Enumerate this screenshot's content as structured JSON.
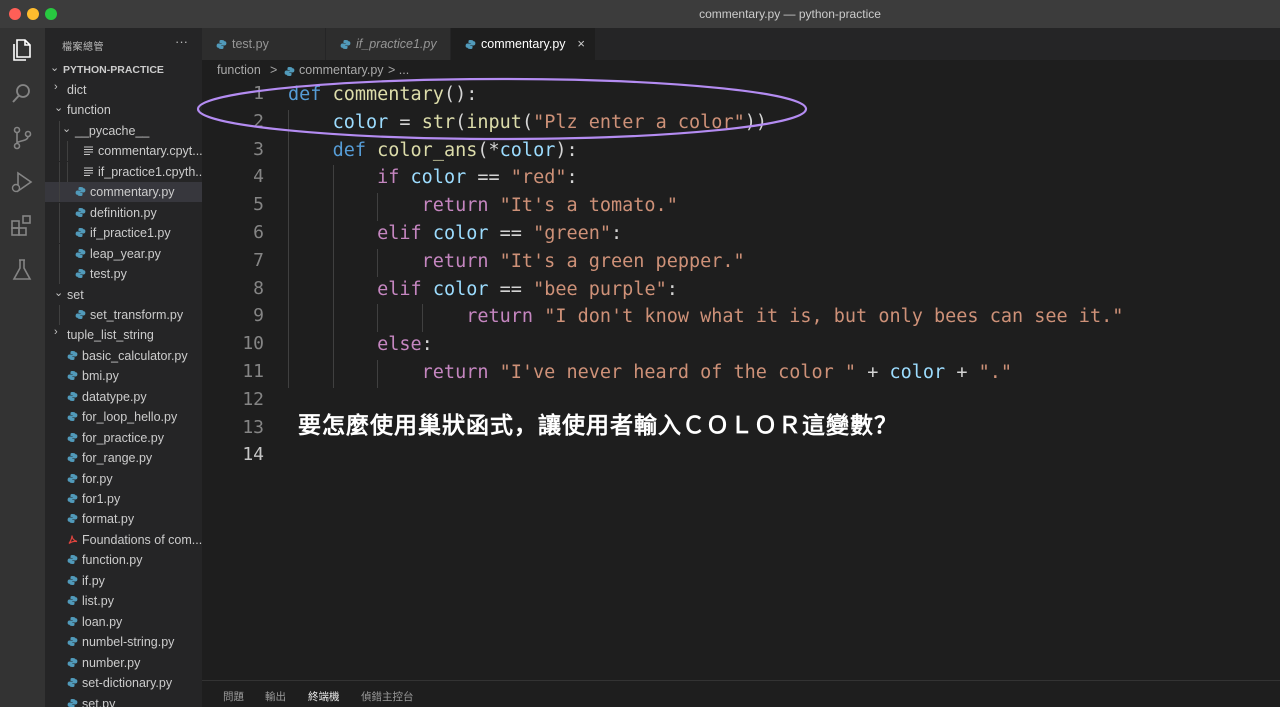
{
  "window": {
    "title": "commentary.py — python-practice"
  },
  "activity_bar": {
    "icons": [
      "files-icon",
      "search-icon",
      "source-control-icon",
      "run-debug-icon",
      "extensions-icon",
      "testing-icon"
    ]
  },
  "sidebar": {
    "title": "檔案總管",
    "more": "···",
    "root": "PYTHON-PRACTICE",
    "items": [
      {
        "label": "dict",
        "type": "folder",
        "open": false
      },
      {
        "label": "function",
        "type": "folder",
        "open": true
      },
      {
        "label": "__pycache__",
        "type": "folder",
        "open": true
      },
      {
        "label": "commentary.cpyt...",
        "type": "file-lines"
      },
      {
        "label": "if_practice1.cpyth...",
        "type": "file-lines"
      },
      {
        "label": "commentary.py",
        "type": "python",
        "active": true
      },
      {
        "label": "definition.py",
        "type": "python"
      },
      {
        "label": "if_practice1.py",
        "type": "python"
      },
      {
        "label": "leap_year.py",
        "type": "python"
      },
      {
        "label": "test.py",
        "type": "python"
      },
      {
        "label": "set",
        "type": "folder",
        "open": true
      },
      {
        "label": "set_transform.py",
        "type": "python"
      },
      {
        "label": "tuple_list_string",
        "type": "folder",
        "open": false
      },
      {
        "label": "basic_calculator.py",
        "type": "python"
      },
      {
        "label": "bmi.py",
        "type": "python"
      },
      {
        "label": "datatype.py",
        "type": "python"
      },
      {
        "label": "for_loop_hello.py",
        "type": "python"
      },
      {
        "label": "for_practice.py",
        "type": "python"
      },
      {
        "label": "for_range.py",
        "type": "python"
      },
      {
        "label": "for.py",
        "type": "python"
      },
      {
        "label": "for1.py",
        "type": "python"
      },
      {
        "label": "format.py",
        "type": "python"
      },
      {
        "label": "Foundations of com...",
        "type": "pdf"
      },
      {
        "label": "function.py",
        "type": "python"
      },
      {
        "label": "if.py",
        "type": "python"
      },
      {
        "label": "list.py",
        "type": "python"
      },
      {
        "label": "loan.py",
        "type": "python"
      },
      {
        "label": "numbel-string.py",
        "type": "python"
      },
      {
        "label": "number.py",
        "type": "python"
      },
      {
        "label": "set-dictionary.py",
        "type": "python"
      },
      {
        "label": "set.py",
        "type": "python"
      }
    ]
  },
  "tabs": [
    {
      "label": "test.py",
      "italic": false,
      "active": false
    },
    {
      "label": "if_practice1.py",
      "italic": true,
      "active": false
    },
    {
      "label": "commentary.py",
      "italic": false,
      "active": true,
      "close": "×"
    }
  ],
  "breadcrumb": {
    "folder": "function",
    "sep1": ">",
    "file": "commentary.py",
    "sep2": "> ..."
  },
  "editor": {
    "line_numbers": [
      "1",
      "2",
      "3",
      "4",
      "5",
      "6",
      "7",
      "8",
      "9",
      "10",
      "11",
      "12",
      "13",
      "14"
    ],
    "lines": [
      "def commentary():",
      "    color = str(input(\"Plz enter a color\"))",
      "    def color_ans(*color):",
      "        if color == \"red\":",
      "            return \"It's a tomato.\"",
      "        elif color == \"green\":",
      "            return \"It's a green pepper.\"",
      "        elif color == \"bee purple\":",
      "                return \"I don't know what it is, but only bees can see it.\"",
      "        else:",
      "            return \"I've never heard of the color \" + color + \".\"",
      "",
      "",
      ""
    ],
    "annotation": "要怎麼使用巢狀函式，讓使用者輸入ＣＯＬＯＲ這變數？",
    "highlight_color": "#b48cf2"
  },
  "panel": {
    "tabs": [
      "問題",
      "輸出",
      "終端機",
      "偵錯主控台"
    ],
    "active": "終端機"
  },
  "colors": {
    "keyword": "#569cd6",
    "control": "#c586c0",
    "function": "#dcdcaa",
    "variable": "#9cdcfe",
    "string": "#ce9178"
  }
}
